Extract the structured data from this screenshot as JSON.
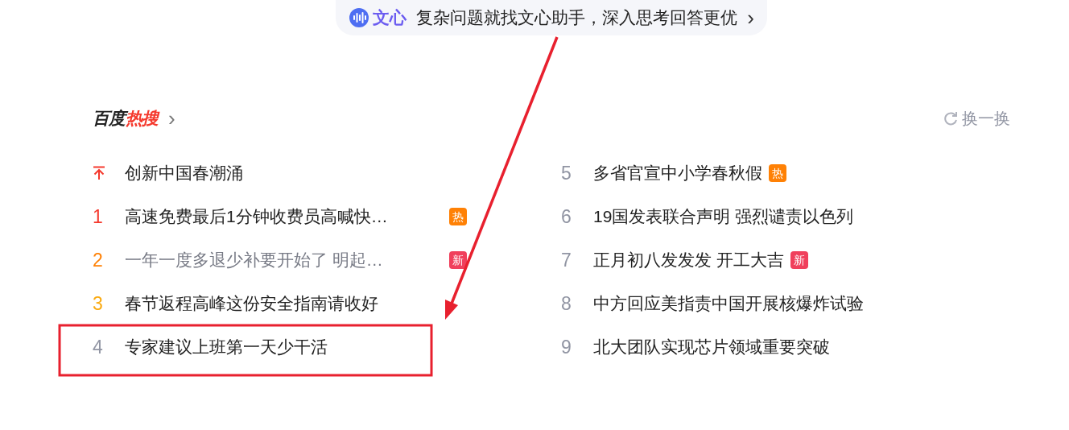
{
  "banner": {
    "brand": "文心",
    "text": "复杂问题就找文心助手，深入思考回答更优",
    "chevron": "›"
  },
  "hot_search": {
    "title_main": "百度",
    "title_accent": "热搜",
    "chevron": "›",
    "refresh": "换一换",
    "columns": [
      [
        {
          "kind": "pinned",
          "title": "创新中国春潮涌",
          "visited": false
        },
        {
          "kind": "ranked",
          "rank": "1",
          "title": "高速免费最后1分钟收费员高喊快…",
          "visited": false,
          "badge": {
            "kind": "hot",
            "text": "热"
          }
        },
        {
          "kind": "ranked",
          "rank": "2",
          "title": "一年一度多退少补要开始了 明起…",
          "visited": true,
          "badge": {
            "kind": "new",
            "text": "新"
          }
        },
        {
          "kind": "ranked",
          "rank": "3",
          "title": "春节返程高峰这份安全指南请收好",
          "visited": false
        },
        {
          "kind": "ranked",
          "rank": "4",
          "title": "专家建议上班第一天少干活",
          "visited": false
        }
      ],
      [
        {
          "kind": "ranked",
          "rank": "5",
          "title": "多省官宣中小学春秋假",
          "visited": false,
          "badge": {
            "kind": "hot",
            "text": "热"
          }
        },
        {
          "kind": "ranked",
          "rank": "6",
          "title": "19国发表联合声明 强烈谴责以色列",
          "visited": false
        },
        {
          "kind": "ranked",
          "rank": "7",
          "title": "正月初八发发发 开工大吉",
          "visited": false,
          "badge": {
            "kind": "new",
            "text": "新"
          }
        },
        {
          "kind": "ranked",
          "rank": "8",
          "title": "中方回应美指责中国开展核爆炸试验",
          "visited": false
        },
        {
          "kind": "ranked",
          "rank": "9",
          "title": "北大团队实现芯片领域重要突破",
          "visited": false
        }
      ]
    ]
  }
}
